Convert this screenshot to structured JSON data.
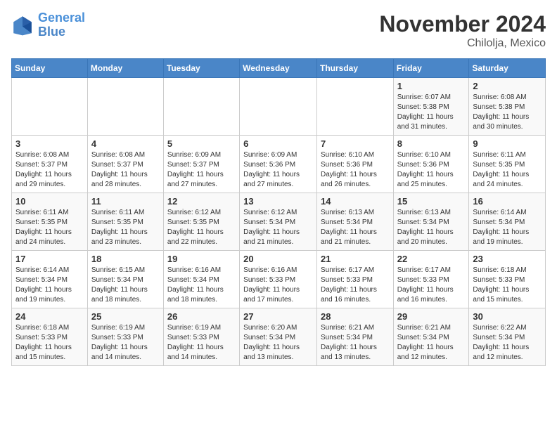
{
  "header": {
    "logo_line1": "General",
    "logo_line2": "Blue",
    "month": "November 2024",
    "location": "Chilolja, Mexico"
  },
  "days_of_week": [
    "Sunday",
    "Monday",
    "Tuesday",
    "Wednesday",
    "Thursday",
    "Friday",
    "Saturday"
  ],
  "weeks": [
    [
      {
        "day": "",
        "sunrise": "",
        "sunset": "",
        "daylight": ""
      },
      {
        "day": "",
        "sunrise": "",
        "sunset": "",
        "daylight": ""
      },
      {
        "day": "",
        "sunrise": "",
        "sunset": "",
        "daylight": ""
      },
      {
        "day": "",
        "sunrise": "",
        "sunset": "",
        "daylight": ""
      },
      {
        "day": "",
        "sunrise": "",
        "sunset": "",
        "daylight": ""
      },
      {
        "day": "1",
        "sunrise": "Sunrise: 6:07 AM",
        "sunset": "Sunset: 5:38 PM",
        "daylight": "Daylight: 11 hours and 31 minutes."
      },
      {
        "day": "2",
        "sunrise": "Sunrise: 6:08 AM",
        "sunset": "Sunset: 5:38 PM",
        "daylight": "Daylight: 11 hours and 30 minutes."
      }
    ],
    [
      {
        "day": "3",
        "sunrise": "Sunrise: 6:08 AM",
        "sunset": "Sunset: 5:37 PM",
        "daylight": "Daylight: 11 hours and 29 minutes."
      },
      {
        "day": "4",
        "sunrise": "Sunrise: 6:08 AM",
        "sunset": "Sunset: 5:37 PM",
        "daylight": "Daylight: 11 hours and 28 minutes."
      },
      {
        "day": "5",
        "sunrise": "Sunrise: 6:09 AM",
        "sunset": "Sunset: 5:37 PM",
        "daylight": "Daylight: 11 hours and 27 minutes."
      },
      {
        "day": "6",
        "sunrise": "Sunrise: 6:09 AM",
        "sunset": "Sunset: 5:36 PM",
        "daylight": "Daylight: 11 hours and 27 minutes."
      },
      {
        "day": "7",
        "sunrise": "Sunrise: 6:10 AM",
        "sunset": "Sunset: 5:36 PM",
        "daylight": "Daylight: 11 hours and 26 minutes."
      },
      {
        "day": "8",
        "sunrise": "Sunrise: 6:10 AM",
        "sunset": "Sunset: 5:36 PM",
        "daylight": "Daylight: 11 hours and 25 minutes."
      },
      {
        "day": "9",
        "sunrise": "Sunrise: 6:11 AM",
        "sunset": "Sunset: 5:35 PM",
        "daylight": "Daylight: 11 hours and 24 minutes."
      }
    ],
    [
      {
        "day": "10",
        "sunrise": "Sunrise: 6:11 AM",
        "sunset": "Sunset: 5:35 PM",
        "daylight": "Daylight: 11 hours and 24 minutes."
      },
      {
        "day": "11",
        "sunrise": "Sunrise: 6:11 AM",
        "sunset": "Sunset: 5:35 PM",
        "daylight": "Daylight: 11 hours and 23 minutes."
      },
      {
        "day": "12",
        "sunrise": "Sunrise: 6:12 AM",
        "sunset": "Sunset: 5:35 PM",
        "daylight": "Daylight: 11 hours and 22 minutes."
      },
      {
        "day": "13",
        "sunrise": "Sunrise: 6:12 AM",
        "sunset": "Sunset: 5:34 PM",
        "daylight": "Daylight: 11 hours and 21 minutes."
      },
      {
        "day": "14",
        "sunrise": "Sunrise: 6:13 AM",
        "sunset": "Sunset: 5:34 PM",
        "daylight": "Daylight: 11 hours and 21 minutes."
      },
      {
        "day": "15",
        "sunrise": "Sunrise: 6:13 AM",
        "sunset": "Sunset: 5:34 PM",
        "daylight": "Daylight: 11 hours and 20 minutes."
      },
      {
        "day": "16",
        "sunrise": "Sunrise: 6:14 AM",
        "sunset": "Sunset: 5:34 PM",
        "daylight": "Daylight: 11 hours and 19 minutes."
      }
    ],
    [
      {
        "day": "17",
        "sunrise": "Sunrise: 6:14 AM",
        "sunset": "Sunset: 5:34 PM",
        "daylight": "Daylight: 11 hours and 19 minutes."
      },
      {
        "day": "18",
        "sunrise": "Sunrise: 6:15 AM",
        "sunset": "Sunset: 5:34 PM",
        "daylight": "Daylight: 11 hours and 18 minutes."
      },
      {
        "day": "19",
        "sunrise": "Sunrise: 6:16 AM",
        "sunset": "Sunset: 5:34 PM",
        "daylight": "Daylight: 11 hours and 18 minutes."
      },
      {
        "day": "20",
        "sunrise": "Sunrise: 6:16 AM",
        "sunset": "Sunset: 5:33 PM",
        "daylight": "Daylight: 11 hours and 17 minutes."
      },
      {
        "day": "21",
        "sunrise": "Sunrise: 6:17 AM",
        "sunset": "Sunset: 5:33 PM",
        "daylight": "Daylight: 11 hours and 16 minutes."
      },
      {
        "day": "22",
        "sunrise": "Sunrise: 6:17 AM",
        "sunset": "Sunset: 5:33 PM",
        "daylight": "Daylight: 11 hours and 16 minutes."
      },
      {
        "day": "23",
        "sunrise": "Sunrise: 6:18 AM",
        "sunset": "Sunset: 5:33 PM",
        "daylight": "Daylight: 11 hours and 15 minutes."
      }
    ],
    [
      {
        "day": "24",
        "sunrise": "Sunrise: 6:18 AM",
        "sunset": "Sunset: 5:33 PM",
        "daylight": "Daylight: 11 hours and 15 minutes."
      },
      {
        "day": "25",
        "sunrise": "Sunrise: 6:19 AM",
        "sunset": "Sunset: 5:33 PM",
        "daylight": "Daylight: 11 hours and 14 minutes."
      },
      {
        "day": "26",
        "sunrise": "Sunrise: 6:19 AM",
        "sunset": "Sunset: 5:33 PM",
        "daylight": "Daylight: 11 hours and 14 minutes."
      },
      {
        "day": "27",
        "sunrise": "Sunrise: 6:20 AM",
        "sunset": "Sunset: 5:34 PM",
        "daylight": "Daylight: 11 hours and 13 minutes."
      },
      {
        "day": "28",
        "sunrise": "Sunrise: 6:21 AM",
        "sunset": "Sunset: 5:34 PM",
        "daylight": "Daylight: 11 hours and 13 minutes."
      },
      {
        "day": "29",
        "sunrise": "Sunrise: 6:21 AM",
        "sunset": "Sunset: 5:34 PM",
        "daylight": "Daylight: 11 hours and 12 minutes."
      },
      {
        "day": "30",
        "sunrise": "Sunrise: 6:22 AM",
        "sunset": "Sunset: 5:34 PM",
        "daylight": "Daylight: 11 hours and 12 minutes."
      }
    ]
  ]
}
